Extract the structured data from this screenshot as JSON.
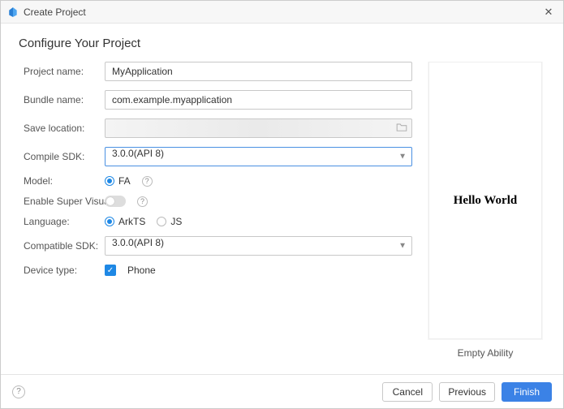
{
  "window": {
    "title": "Create Project"
  },
  "heading": "Configure Your Project",
  "fields": {
    "project_name": {
      "label": "Project name:",
      "value": "MyApplication"
    },
    "bundle_name": {
      "label": "Bundle name:",
      "value": "com.example.myapplication"
    },
    "save_location": {
      "label": "Save location:",
      "value": ""
    },
    "compile_sdk": {
      "label": "Compile SDK:",
      "value": "3.0.0(API 8)"
    },
    "model": {
      "label": "Model:",
      "options": [
        "FA"
      ]
    },
    "enable_super_visual": {
      "label": "Enable Super Visual:"
    },
    "language": {
      "label": "Language:",
      "options": [
        "ArkTS",
        "JS"
      ]
    },
    "compatible_sdk": {
      "label": "Compatible SDK:",
      "value": "3.0.0(API 8)"
    },
    "device_type": {
      "label": "Device type:",
      "option": "Phone"
    }
  },
  "preview": {
    "text": "Hello World",
    "caption": "Empty Ability"
  },
  "footer": {
    "cancel": "Cancel",
    "previous": "Previous",
    "finish": "Finish"
  }
}
